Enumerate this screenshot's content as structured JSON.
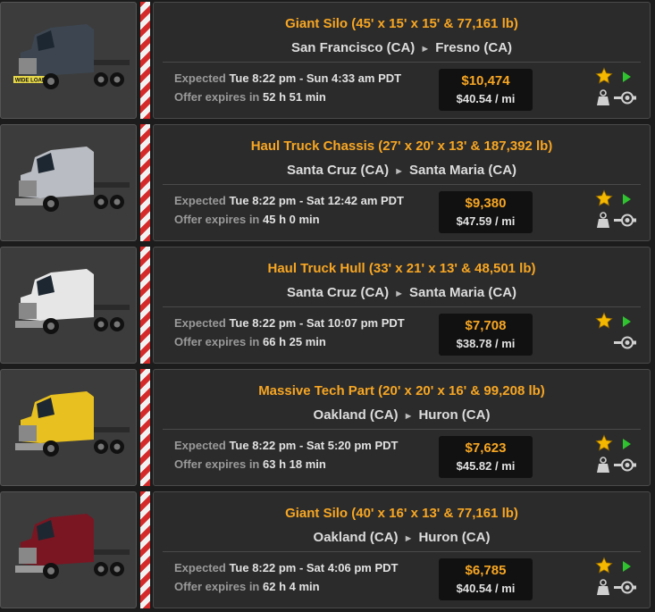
{
  "labels": {
    "expected": "Expected",
    "offer_expires": "Offer expires in"
  },
  "icons": {
    "star": "star-icon",
    "play": "play-icon",
    "weight": "weight-icon",
    "hitch": "trailer-hitch-icon"
  },
  "jobs": [
    {
      "cargo": "Giant Silo (45' x 15' x 15' & 77,161 lb)",
      "origin": "San Francisco (CA)",
      "destination": "Fresno (CA)",
      "expected": "Tue 8:22 pm - Sun 4:33 am PDT",
      "expires": "52 h 51 min",
      "pay": "$10,474",
      "rate": "$40.54 / mi",
      "heavy": true,
      "truck_color": "#3d4650",
      "truck_plate": "WIDE LOAD"
    },
    {
      "cargo": "Haul Truck Chassis (27' x 20' x 13' & 187,392 lb)",
      "origin": "Santa Cruz (CA)",
      "destination": "Santa Maria (CA)",
      "expected": "Tue 8:22 pm - Sat 12:42 am PDT",
      "expires": "45 h 0 min",
      "pay": "$9,380",
      "rate": "$47.59 / mi",
      "heavy": true,
      "truck_color": "#b9bcc2",
      "truck_plate": ""
    },
    {
      "cargo": "Haul Truck Hull (33' x 21' x 13' & 48,501 lb)",
      "origin": "Santa Cruz (CA)",
      "destination": "Santa Maria (CA)",
      "expected": "Tue 8:22 pm - Sat 10:07 pm PDT",
      "expires": "66 h 25 min",
      "pay": "$7,708",
      "rate": "$38.78 / mi",
      "heavy": false,
      "truck_color": "#e6e6e6",
      "truck_plate": ""
    },
    {
      "cargo": "Massive Tech Part (20' x 20' x 16' & 99,208 lb)",
      "origin": "Oakland (CA)",
      "destination": "Huron (CA)",
      "expected": "Tue 8:22 pm - Sat 5:20 pm PDT",
      "expires": "63 h 18 min",
      "pay": "$7,623",
      "rate": "$45.82 / mi",
      "heavy": true,
      "truck_color": "#e8c020",
      "truck_plate": ""
    },
    {
      "cargo": "Giant Silo (40' x 16' x 13' & 77,161 lb)",
      "origin": "Oakland (CA)",
      "destination": "Huron (CA)",
      "expected": "Tue 8:22 pm - Sat 4:06 pm PDT",
      "expires": "62 h 4 min",
      "pay": "$6,785",
      "rate": "$40.54 / mi",
      "heavy": true,
      "truck_color": "#7a1622",
      "truck_plate": ""
    }
  ]
}
